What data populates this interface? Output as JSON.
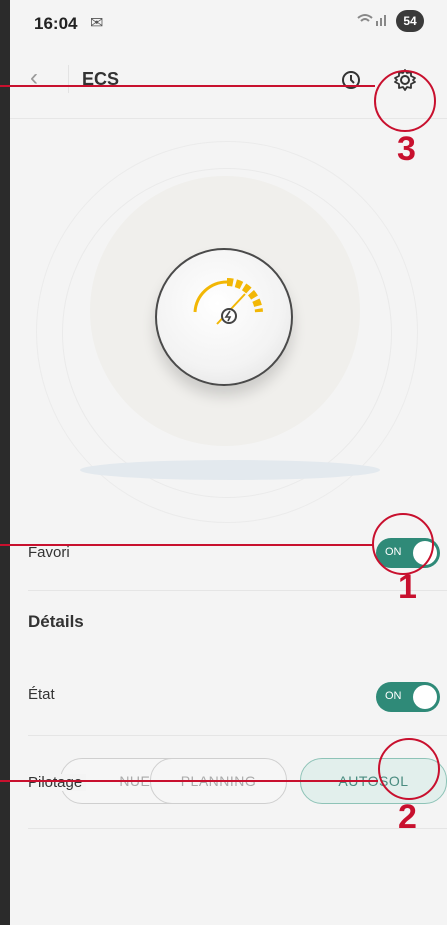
{
  "status_bar": {
    "time": "16:04",
    "battery": "54"
  },
  "app_bar": {
    "back_icon": "arrow-left-icon",
    "title": "ECS",
    "history_icon": "history-icon",
    "settings_icon": "gear-icon"
  },
  "favorite": {
    "label": "Favori",
    "toggle": "ON"
  },
  "details": {
    "title": "Détails",
    "state": {
      "label": "État",
      "toggle": "ON"
    },
    "pilotage": {
      "label": "Pilotage",
      "options": [
        "MANUEL",
        "PLANNING",
        "AUTOSOL"
      ],
      "visible_first": "NUEL",
      "selected": "AUTOSOL"
    }
  },
  "annotations": [
    "1",
    "2",
    "3"
  ],
  "colors": {
    "accent": "#2f8a78",
    "annotation": "#c8102e",
    "gauge": "#f2b705"
  }
}
